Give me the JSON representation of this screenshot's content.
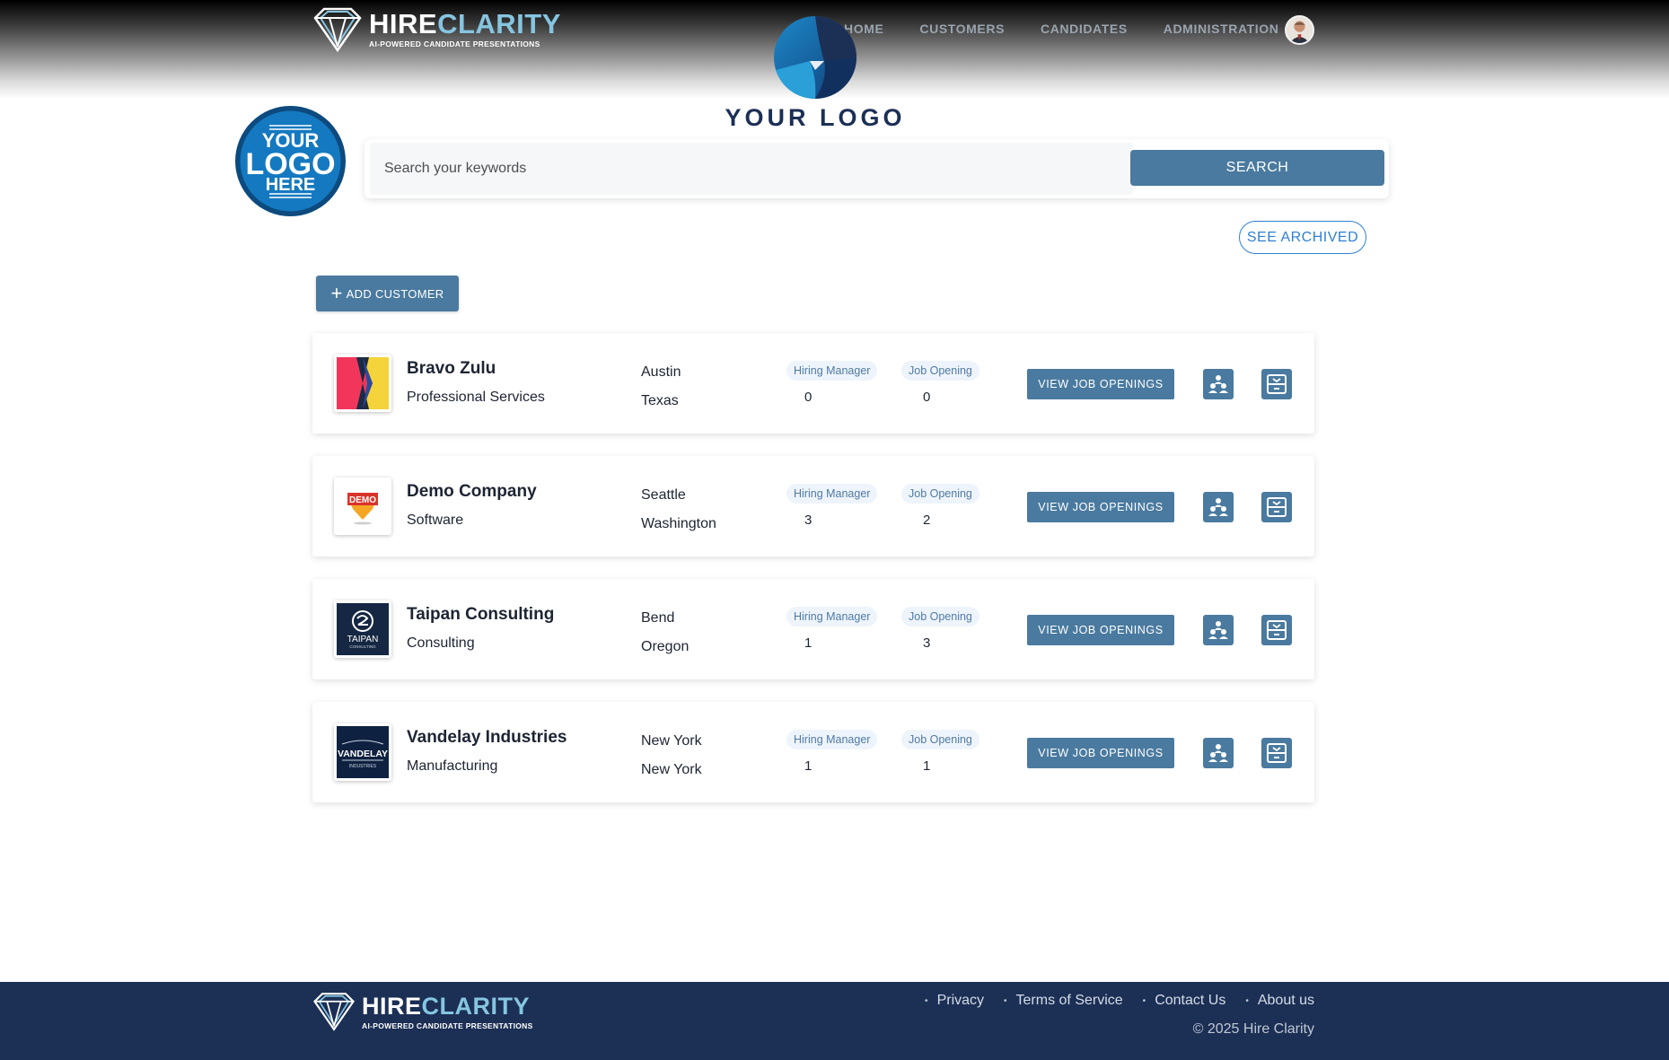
{
  "brand": {
    "name_part1": "HIRE",
    "name_part2": "CLARITY",
    "tagline": "AI-POWERED CANDIDATE PRESENTATIONS"
  },
  "nav": {
    "items": [
      "HOME",
      "CUSTOMERS",
      "CANDIDATES",
      "ADMINISTRATION"
    ]
  },
  "your_logo": {
    "text": "YOUR LOGO"
  },
  "left_logo": {
    "line1": "YOUR",
    "line2": "LOGO",
    "line3": "HERE"
  },
  "search": {
    "placeholder": "Search your keywords",
    "button_label": "SEARCH"
  },
  "archived_label": "SEE ARCHIVED",
  "add_customer_label": "ADD CUSTOMER",
  "labels": {
    "hiring_manager": "Hiring Manager",
    "job_opening": "Job Opening",
    "view_job_openings": "VIEW JOB OPENINGS"
  },
  "customers": [
    {
      "name": "Bravo Zulu",
      "industry": "Professional Services",
      "city": "Austin",
      "state": "Texas",
      "hiring_managers": "0",
      "job_openings": "0",
      "logo": "flag-logo"
    },
    {
      "name": "Demo Company",
      "industry": "Software",
      "city": "Seattle",
      "state": "Washington",
      "hiring_managers": "3",
      "job_openings": "2",
      "logo": "demo-logo",
      "logo_text": "DEMO"
    },
    {
      "name": "Taipan Consulting",
      "industry": "Consulting",
      "city": "Bend",
      "state": "Oregon",
      "hiring_managers": "1",
      "job_openings": "3",
      "logo": "taipan-logo",
      "logo_text": "TAIPAN",
      "logo_subtext": "CONSULTING"
    },
    {
      "name": "Vandelay Industries",
      "industry": "Manufacturing",
      "city": "New York",
      "state": "New York",
      "hiring_managers": "1",
      "job_openings": "1",
      "logo": "vandelay-logo",
      "logo_text": "VANDELAY",
      "logo_subtext": "INDUSTRIES"
    }
  ],
  "footer": {
    "links": [
      "Privacy",
      "Terms of Service",
      "Contact Us",
      "About us"
    ],
    "copyright": "© 2025 Hire Clarity"
  },
  "colors": {
    "accent": "#4a7a9f",
    "footer_bg": "#1c2f55",
    "brand_light": "#86c5e0",
    "link_blue": "#2f80d0"
  }
}
